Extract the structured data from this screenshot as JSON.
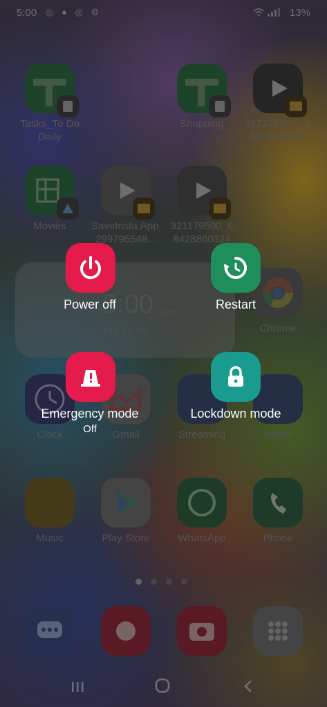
{
  "status_bar": {
    "time": "5:00",
    "notification_icons": [
      "whatsapp-icon",
      "user-icon",
      "whatsapp-icon",
      "settings-icon"
    ],
    "right_icons": "wifi-icon signal-icon",
    "battery": "13%"
  },
  "home": {
    "apps": [
      {
        "label": "Tasks_To Do\nDaily",
        "color": "#1e6b3a"
      },
      {
        "label": "Shopping",
        "color": "#1e6b3a"
      },
      {
        "label": "31727230 4_1\n6610439643",
        "color": "#333333"
      },
      {
        "label": "Movies",
        "color": "#1e6b3a"
      },
      {
        "label": "SaveInsta.App_\n299795548...",
        "color": "#444444"
      },
      {
        "label": "321179500_6\n8428860324",
        "color": "#444444"
      },
      {
        "label": "Chrome",
        "color": "#555555"
      },
      {
        "label": "Clock",
        "color": "#2a2a6a"
      },
      {
        "label": "Gmail",
        "color": "#5a5a5a"
      },
      {
        "label": "Streaming",
        "color": "#2a3a6a"
      },
      {
        "label": "Notes",
        "color": "#2a3a6a"
      },
      {
        "label": "Music",
        "color": "#6a4a1a"
      },
      {
        "label": "Play Store",
        "color": "#5a5a5a"
      },
      {
        "label": "WhatsApp",
        "color": "#1f5a3a"
      },
      {
        "label": "Phone",
        "color": "#1f5a3a"
      }
    ],
    "widget": {
      "time": "5:00",
      "ampm": "pm",
      "date": "Tue, 18 Apr"
    }
  },
  "power_menu": {
    "power_off": {
      "label": "Power off",
      "color": "#e51c4b"
    },
    "restart": {
      "label": "Restart",
      "color": "#1e8f5a"
    },
    "emergency": {
      "label": "Emergency mode",
      "status": "Off",
      "color": "#e51c4b"
    },
    "lockdown": {
      "label": "Lockdown mode",
      "color": "#1a9b8f"
    }
  },
  "nav_bar": {
    "recents": "recents-icon",
    "home": "home-icon",
    "back": "back-icon"
  }
}
